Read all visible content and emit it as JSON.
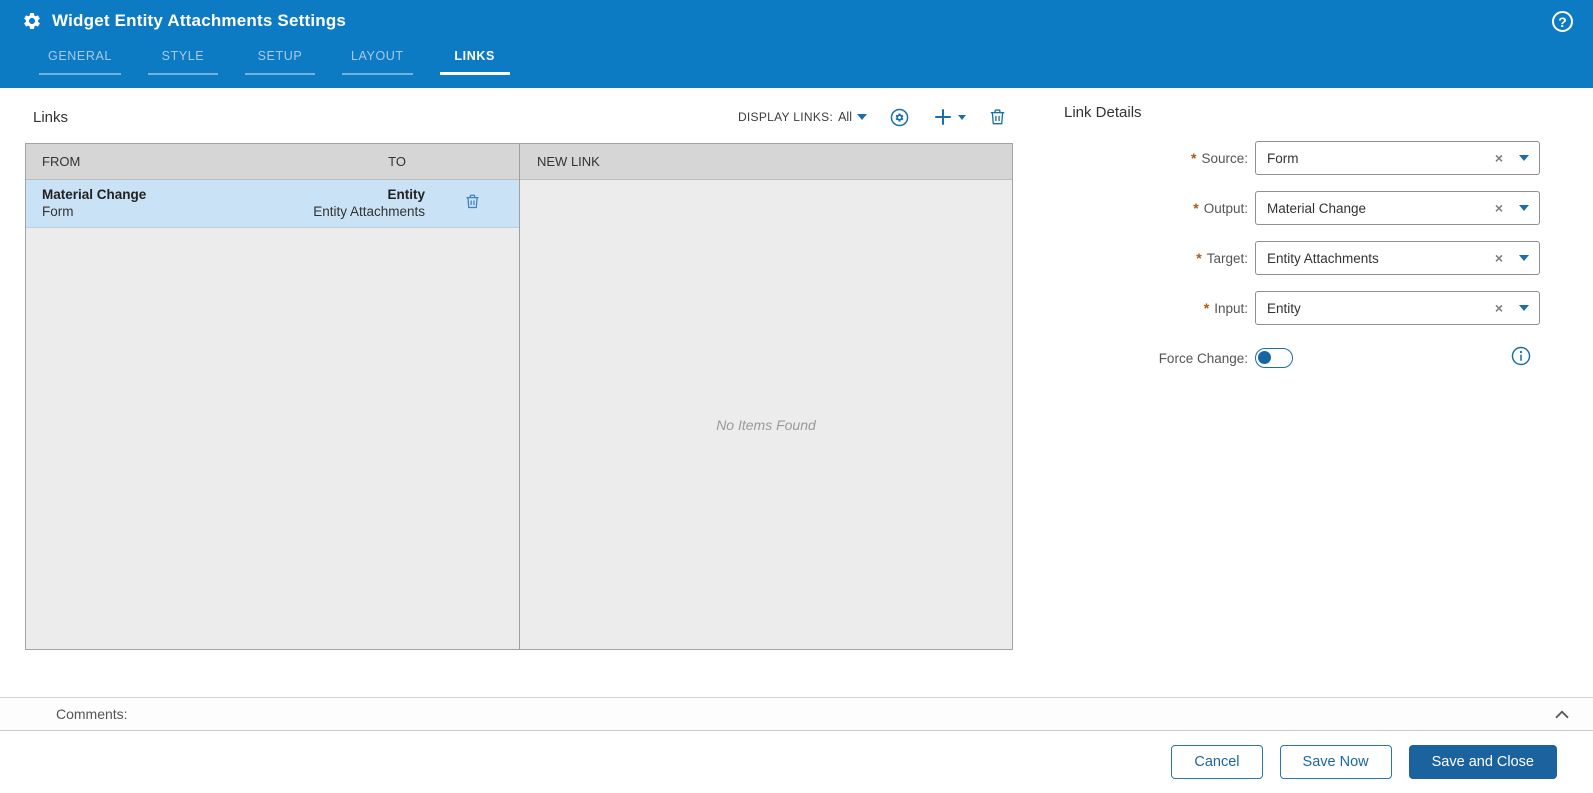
{
  "header": {
    "title": "Widget Entity Attachments Settings",
    "tabs": [
      {
        "label": "GENERAL",
        "active": false
      },
      {
        "label": "STYLE",
        "active": false
      },
      {
        "label": "SETUP",
        "active": false
      },
      {
        "label": "LAYOUT",
        "active": false
      },
      {
        "label": "LINKS",
        "active": true
      }
    ],
    "help_glyph": "?"
  },
  "links_panel": {
    "title": "Links",
    "display_links_label": "DISPLAY LINKS:",
    "display_links_value": "All",
    "columns": {
      "from": "FROM",
      "to": "TO",
      "new_link": "NEW LINK"
    },
    "rows": [
      {
        "from_title": "Material Change",
        "from_subtitle": "Form",
        "to_title": "Entity",
        "to_subtitle": "Entity Attachments",
        "selected": true
      }
    ],
    "new_link_empty_text": "No Items Found"
  },
  "link_details": {
    "title": "Link Details",
    "required_mark": "*",
    "fields": [
      {
        "label": "Source:",
        "value": "Form",
        "required": true
      },
      {
        "label": "Output:",
        "value": "Material Change",
        "required": true
      },
      {
        "label": "Target:",
        "value": "Entity Attachments",
        "required": true
      },
      {
        "label": "Input:",
        "value": "Entity",
        "required": true
      }
    ],
    "clear_glyph": "×",
    "force_change_label": "Force Change:",
    "force_change_on": false
  },
  "comments": {
    "label": "Comments:"
  },
  "footer": {
    "cancel_label": "Cancel",
    "save_now_label": "Save Now",
    "save_close_label": "Save and Close"
  },
  "colors": {
    "header_blue": "#0d7ac4",
    "icon_blue": "#1b6fa8",
    "selected_row": "#c9e2f5",
    "table_header": "#d6d6d6",
    "table_body": "#ececec",
    "primary_button": "#1a639e",
    "required_mark": "#ab5715"
  }
}
